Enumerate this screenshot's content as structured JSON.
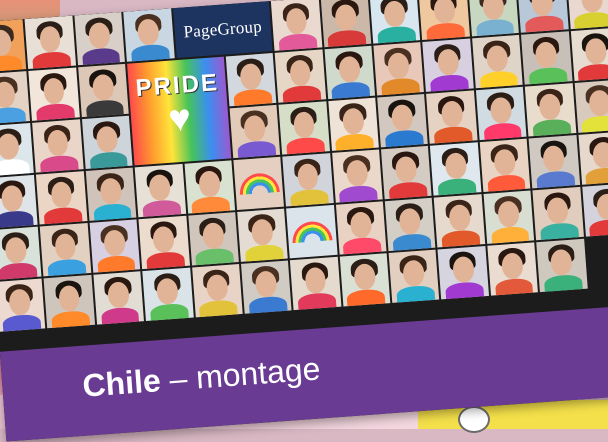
{
  "brand": {
    "name": "PageGroup",
    "color": "#1d3461"
  },
  "pride_sign": {
    "text": "PRIDE"
  },
  "caption": {
    "country": "Chile",
    "separator": "–",
    "subtitle": "montage"
  },
  "colors": {
    "banner": "#6a3b93",
    "highlight": "#f4e04a"
  },
  "tiles": [
    {
      "bg": "#f2a15a",
      "shirt": "#ff8a2a",
      "hair": "#3a2a20"
    },
    {
      "bg": "#e8e0d6",
      "shirt": "#e23a3a",
      "hair": "#2a1e16"
    },
    {
      "bg": "#d8d0c8",
      "shirt": "#5a3a8a",
      "hair": "#2a1e16"
    },
    {
      "bg": "#c9d7e3",
      "shirt": "#3a8ad0",
      "hair": "#4a3020"
    },
    {
      "bg": "#e9d9cf",
      "shirt": "#e25a9a",
      "hair": "#3a2418"
    },
    {
      "bg": "#cbb8a8",
      "shirt": "#d83a3a",
      "hair": "#2a1810"
    },
    {
      "bg": "#d7e6ef",
      "shirt": "#2ab0a0",
      "hair": "#2a1e16"
    },
    {
      "bg": "#f0c8a0",
      "shirt": "#ff6a3a",
      "hair": "#2a1810"
    },
    {
      "bg": "#c8d8c0",
      "shirt": "#7ab0d0",
      "hair": "#3a2a20"
    },
    {
      "bg": "#b8c8d8",
      "shirt": "#e25a5a",
      "hair": "#2a1e16"
    },
    {
      "bg": "#e8d8d0",
      "shirt": "#d8d030",
      "hair": "#3a2418"
    },
    {
      "bg": "#e4d2c4",
      "shirt": "#4aa0e0",
      "hair": "#4a3020"
    },
    {
      "bg": "#f2e6da",
      "shirt": "#e23a6a",
      "hair": "#2a1810"
    },
    {
      "bg": "#ddc8b8",
      "shirt": "#3a3a3a",
      "hair": "#1a1410"
    },
    {
      "bg": "#d2d8de",
      "shirt": "#ff7a2a",
      "hair": "#2a1e16"
    },
    {
      "bg": "#e6d6c6",
      "shirt": "#e23a3a",
      "hair": "#3a2418"
    },
    {
      "bg": "#cfd9cc",
      "shirt": "#3a7ad0",
      "hair": "#2a1810"
    },
    {
      "bg": "#e8c8b8",
      "shirt": "#e28a2a",
      "hair": "#4a3020"
    },
    {
      "bg": "#d8d0e0",
      "shirt": "#a03ad0",
      "hair": "#2a1e16"
    },
    {
      "bg": "#e0d4c8",
      "shirt": "#ffd02a",
      "hair": "#3a2418"
    },
    {
      "bg": "#c8c0b8",
      "shirt": "#5ac05a",
      "hair": "#2a1810"
    },
    {
      "bg": "#e6dccf",
      "shirt": "#e23a3a",
      "hair": "#1a1410"
    },
    {
      "bg": "#dde6ea",
      "shirt": "#ffffff",
      "hair": "#2a1e16"
    },
    {
      "bg": "#ead6c8",
      "shirt": "#d84a8a",
      "hair": "#3a2418"
    },
    {
      "bg": "#cdd5db",
      "shirt": "#3a9a9a",
      "hair": "#2a1810"
    },
    {
      "bg": "#e2cbb8",
      "shirt": "#7a5ad0",
      "hair": "#4a3020"
    },
    {
      "bg": "#d6dec8",
      "shirt": "#ff4a4a",
      "hair": "#2a1e16"
    },
    {
      "bg": "#efe2d6",
      "shirt": "#ffb02a",
      "hair": "#3a2418"
    },
    {
      "bg": "#d3c8bf",
      "shirt": "#2a7ad0",
      "hair": "#1a1410"
    },
    {
      "bg": "#e6d2c2",
      "shirt": "#e25a2a",
      "hair": "#2a1810"
    },
    {
      "bg": "#d0dbe2",
      "shirt": "#ff3a6a",
      "hair": "#2a1e16"
    },
    {
      "bg": "#e8dccc",
      "shirt": "#5ab05a",
      "hair": "#3a2418"
    },
    {
      "bg": "#d8cabd",
      "shirt": "#e2e23a",
      "hair": "#4a3020"
    },
    {
      "bg": "#dfe4e8",
      "shirt": "#3a3a8a",
      "hair": "#2a1810"
    },
    {
      "bg": "#ebd5c5",
      "shirt": "#e23a3a",
      "hair": "#2a1e16"
    },
    {
      "bg": "#d0c4ba",
      "shirt": "#2ab0d0",
      "hair": "#3a2418"
    },
    {
      "bg": "#e6e0d6",
      "shirt": "#d05a9a",
      "hair": "#1a1410"
    },
    {
      "bg": "#d9e2d0",
      "shirt": "#ff8a3a",
      "hair": "#2a1810"
    },
    {
      "bg": "#e4cfc0",
      "shirt": "#4a8ae0",
      "hair": "#2a1e16"
    },
    {
      "bg": "#d2d4dc",
      "shirt": "#e2c23a",
      "hair": "#3a2418"
    },
    {
      "bg": "#ead8ca",
      "shirt": "#a04ad0",
      "hair": "#4a3020"
    },
    {
      "bg": "#d4ccc2",
      "shirt": "#e23a3a",
      "hair": "#2a1810"
    },
    {
      "bg": "#dfe8ee",
      "shirt": "#3ab07a",
      "hair": "#2a1e16"
    },
    {
      "bg": "#e9d3c2",
      "shirt": "#ff5a3a",
      "hair": "#3a2418"
    },
    {
      "bg": "#cfc9c2",
      "shirt": "#5a7ad0",
      "hair": "#1a1410"
    },
    {
      "bg": "#e6d8ca",
      "shirt": "#e2a03a",
      "hair": "#2a1810"
    },
    {
      "bg": "#d8e2da",
      "shirt": "#d03a6a",
      "hair": "#2a1e16"
    },
    {
      "bg": "#e2d0c0",
      "shirt": "#3aa0e0",
      "hair": "#3a2418"
    },
    {
      "bg": "#d6d0e2",
      "shirt": "#ff7a2a",
      "hair": "#4a3020"
    },
    {
      "bg": "#ecdcce",
      "shirt": "#e23a3a",
      "hair": "#2a1810"
    },
    {
      "bg": "#d0c6bc",
      "shirt": "#6ac06a",
      "hair": "#2a1e16"
    },
    {
      "bg": "#e4dcd2",
      "shirt": "#e2d23a",
      "hair": "#3a2418"
    },
    {
      "bg": "#dbe4ea",
      "shirt": "#8a3ad0",
      "hair": "#1a1410"
    },
    {
      "bg": "#e8d2c4",
      "shirt": "#ff4a6a",
      "hair": "#2a1810"
    },
    {
      "bg": "#d3cfc6",
      "shirt": "#3a8ad0",
      "hair": "#2a1e16"
    },
    {
      "bg": "#e6dace",
      "shirt": "#e25a2a",
      "hair": "#3a2418"
    },
    {
      "bg": "#d8dfd2",
      "shirt": "#ffb03a",
      "hair": "#4a3020"
    },
    {
      "bg": "#e0cdbd",
      "shirt": "#3ab0a0",
      "hair": "#2a1810"
    },
    {
      "bg": "#d4d2dc",
      "shirt": "#e23a3a",
      "hair": "#2a1e16"
    },
    {
      "bg": "#ecdad0",
      "shirt": "#5a5ad0",
      "hair": "#3a2418"
    },
    {
      "bg": "#cec6bd",
      "shirt": "#ff8a2a",
      "hair": "#1a1410"
    },
    {
      "bg": "#e2ddd4",
      "shirt": "#d03a8a",
      "hair": "#2a1810"
    },
    {
      "bg": "#d9e3e8",
      "shirt": "#5ac05a",
      "hair": "#2a1e16"
    },
    {
      "bg": "#e8d4c6",
      "shirt": "#e2c23a",
      "hair": "#3a2418"
    },
    {
      "bg": "#d0ccc4",
      "shirt": "#3a7ad0",
      "hair": "#4a3020"
    },
    {
      "bg": "#e4dace",
      "shirt": "#e23a5a",
      "hair": "#2a1810"
    },
    {
      "bg": "#dbe0d4",
      "shirt": "#ff6a2a",
      "hair": "#2a1e16"
    },
    {
      "bg": "#e2cfc0",
      "shirt": "#2ab0d0",
      "hair": "#3a2418"
    },
    {
      "bg": "#d6d4de",
      "shirt": "#a03ad0",
      "hair": "#1a1410"
    },
    {
      "bg": "#eadcd0",
      "shirt": "#e25a3a",
      "hair": "#2a1810"
    },
    {
      "bg": "#cfc8bf",
      "shirt": "#3ab07a",
      "hair": "#2a1e16"
    },
    {
      "bg": "#e6ddd2",
      "shirt": "#e2e23a",
      "hair": "#3a2418"
    },
    {
      "bg": "#d6dde6",
      "shirt": "#e23a3a",
      "hair": "#4a3020"
    },
    {
      "bg": "#e8d6c8",
      "shirt": "#5a9ae0",
      "hair": "#2a1810"
    },
    {
      "bg": "#d2cec6",
      "shirt": "#ff5a8a",
      "hair": "#2a1e16"
    },
    {
      "bg": "#e2d8cc",
      "shirt": "#7ac05a",
      "hair": "#3a2418"
    },
    {
      "bg": "#dce2d8",
      "shirt": "#ffa02a",
      "hair": "#1a1410"
    },
    {
      "bg": "#e0ccbc",
      "shirt": "#3a5ad0",
      "hair": "#2a1810"
    }
  ]
}
